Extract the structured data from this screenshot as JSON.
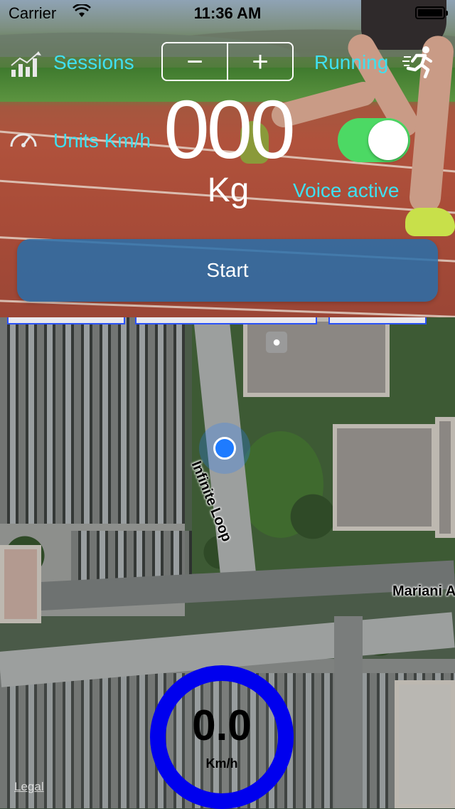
{
  "status_bar": {
    "carrier": "Carrier",
    "time": "11:36 AM"
  },
  "controls": {
    "sessions_label": "Sessions",
    "stepper_minus": "−",
    "stepper_plus": "+",
    "activity_label": "Running",
    "units_label": "Units Km/h",
    "weight_value": "000",
    "weight_unit": "Kg",
    "voice_label": "Voice active",
    "voice_enabled": true,
    "start_label": "Start"
  },
  "map": {
    "road_label_1": "Infinite Loop",
    "road_label_2": "Mariani A",
    "legal_label": "Legal"
  },
  "speedometer": {
    "value": "0.0",
    "unit": "Km/h"
  },
  "colors": {
    "accent_cyan": "#3fe0f0",
    "toggle_on": "#4cd964",
    "start_button": "#286eaa",
    "gauge_ring": "#0000ee"
  },
  "icons": {
    "sessions": "bar-chart-icon",
    "running": "runner-icon",
    "speed": "speedometer-icon",
    "location": "user-location-icon"
  }
}
